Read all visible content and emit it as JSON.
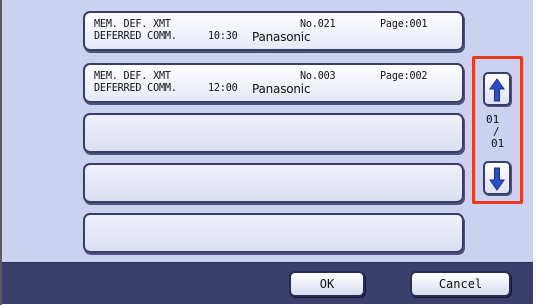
{
  "list": {
    "rows": [
      {
        "mode": "MEM. DEF. XMT",
        "status": "DEFERRED COMM.",
        "time": "10:30",
        "number": "No.021",
        "page": "Page:001",
        "name": "Panasonic"
      },
      {
        "mode": "MEM. DEF. XMT",
        "status": "DEFERRED COMM.",
        "time": "12:00",
        "number": "No.003",
        "page": "Page:002",
        "name": "Panasonic"
      }
    ],
    "empty_rows": 3
  },
  "scroll": {
    "current_page": "01",
    "separator": "/",
    "total_pages": "01",
    "highlight_color": "#ea3a1e"
  },
  "footer": {
    "ok_label": "OK",
    "cancel_label": "Cancel"
  },
  "colors": {
    "panel_bg": "#cbd2f0",
    "footer_bg": "#3b3f6b",
    "arrow_color": "#2c4fc6"
  }
}
